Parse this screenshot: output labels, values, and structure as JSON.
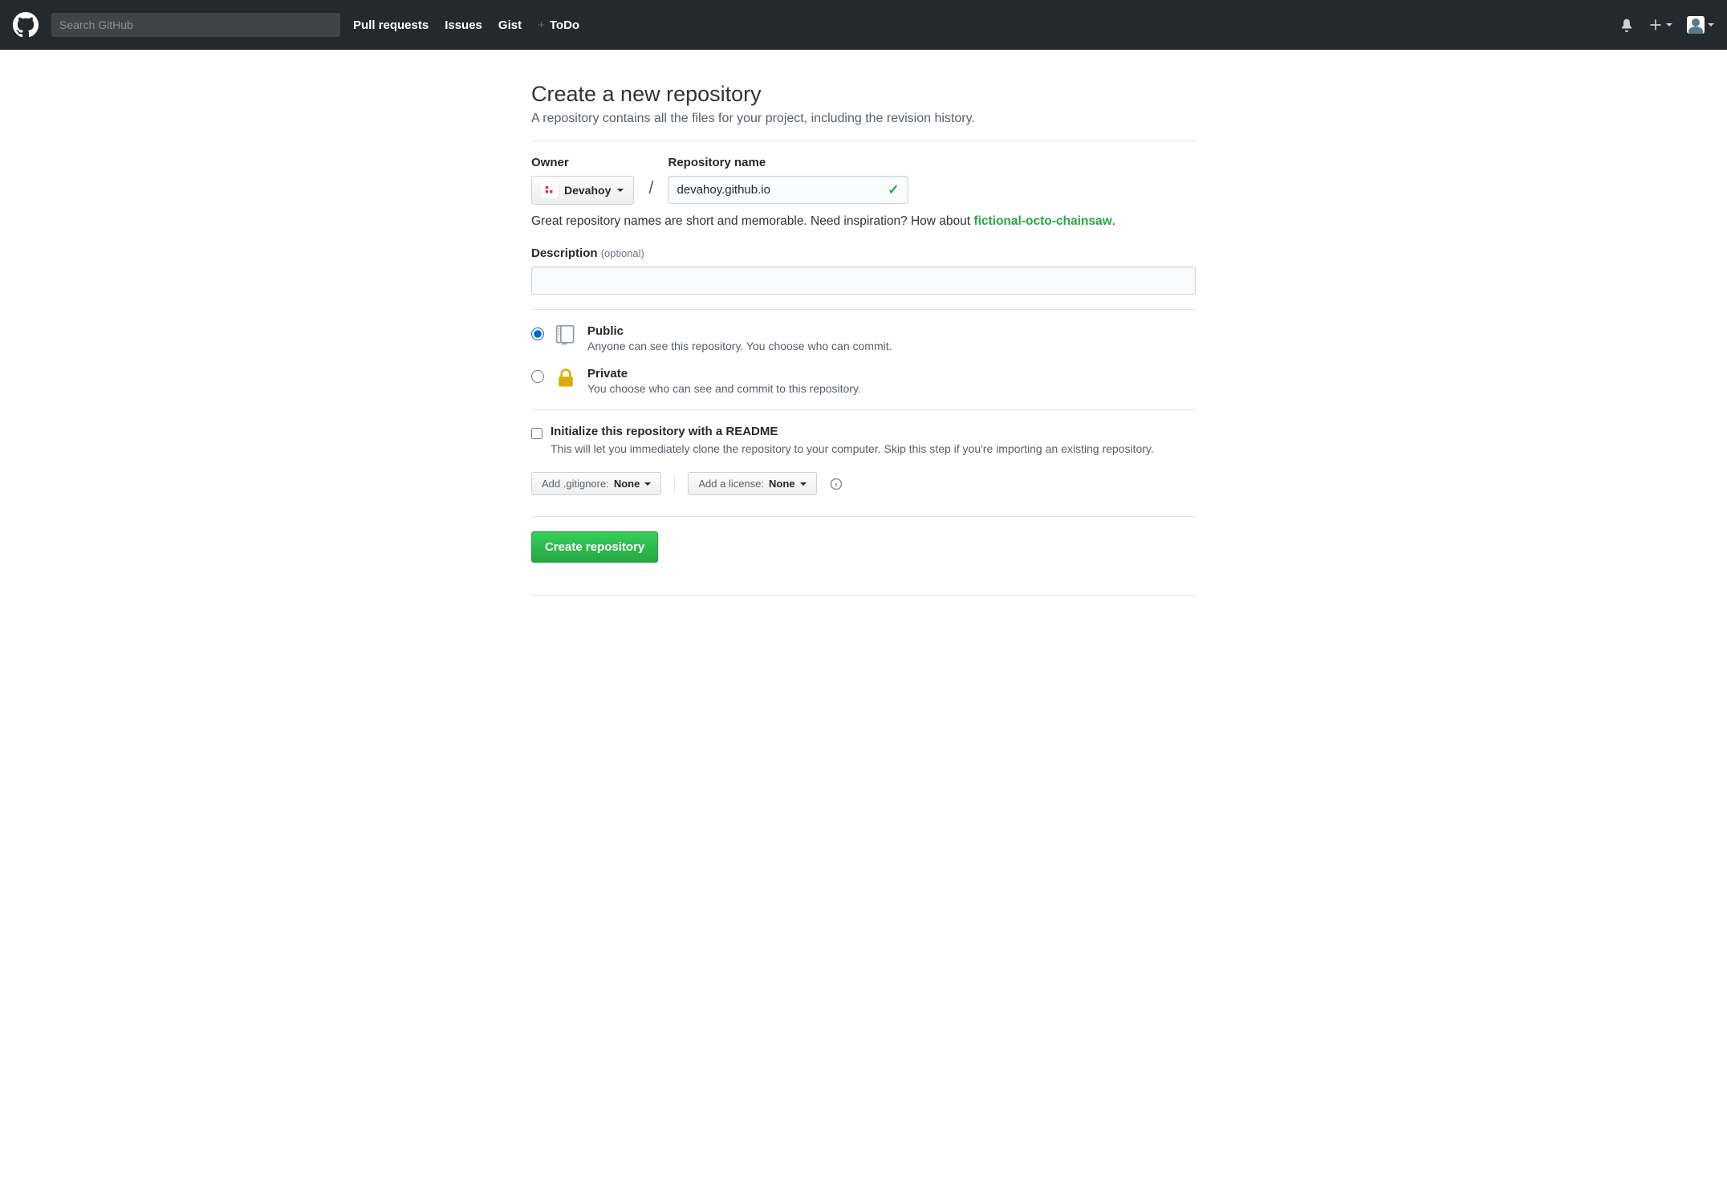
{
  "header": {
    "search_placeholder": "Search GitHub",
    "nav": {
      "pull_requests": "Pull requests",
      "issues": "Issues",
      "gist": "Gist",
      "todo": "ToDo"
    }
  },
  "page": {
    "title": "Create a new repository",
    "subhead": "A repository contains all the files for your project, including the revision history."
  },
  "owner": {
    "label": "Owner",
    "selected": "Devahoy"
  },
  "repo": {
    "label": "Repository name",
    "value": "devahoy.github.io",
    "hint_prefix": "Great repository names are short and memorable. Need inspiration? How about ",
    "suggestion": "fictional-octo-chainsaw",
    "hint_suffix": "."
  },
  "description": {
    "label": "Description",
    "optional": "(optional)",
    "value": ""
  },
  "visibility": {
    "public": {
      "title": "Public",
      "desc": "Anyone can see this repository. You choose who can commit."
    },
    "private": {
      "title": "Private",
      "desc": "You choose who can see and commit to this repository."
    }
  },
  "init": {
    "title": "Initialize this repository with a README",
    "desc": "This will let you immediately clone the repository to your computer. Skip this step if you're importing an existing repository."
  },
  "selectors": {
    "gitignore_prefix": "Add .gitignore: ",
    "gitignore_value": "None",
    "license_prefix": "Add a license: ",
    "license_value": "None"
  },
  "submit": {
    "label": "Create repository"
  }
}
